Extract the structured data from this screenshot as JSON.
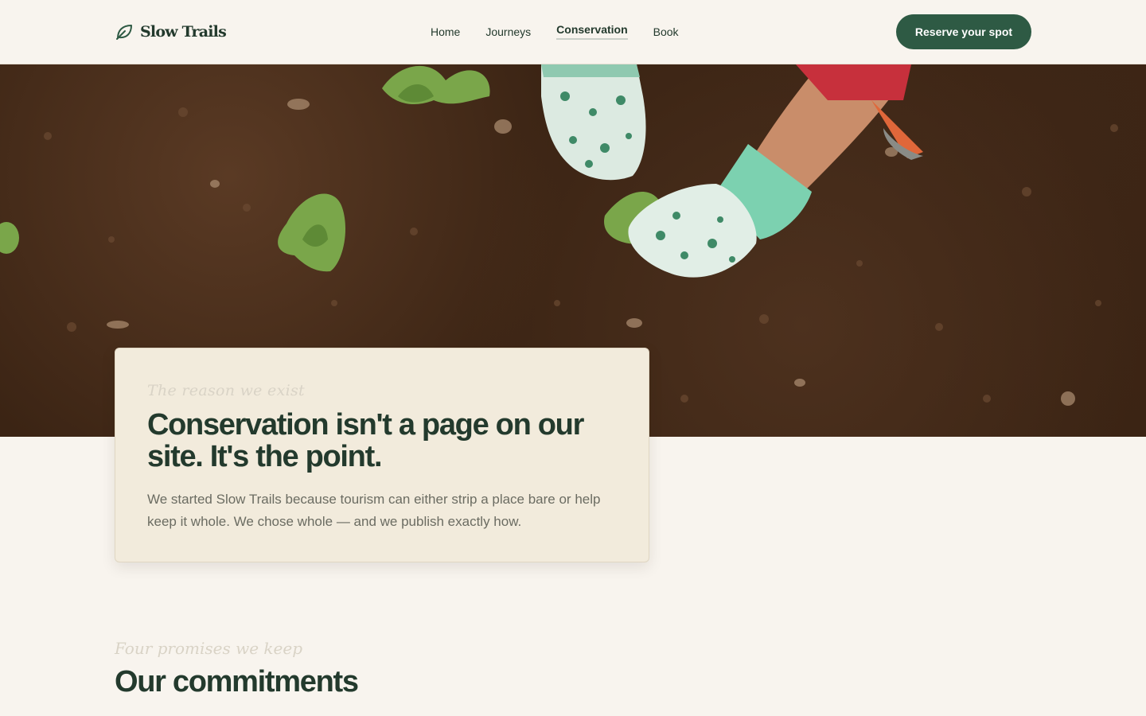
{
  "brand": {
    "name": "Slow Trails",
    "icon": "leaf-icon"
  },
  "nav": {
    "items": [
      {
        "label": "Home"
      },
      {
        "label": "Journeys"
      },
      {
        "label": "Conservation",
        "active": true
      },
      {
        "label": "Book"
      }
    ]
  },
  "header": {
    "cta_label": "Reserve your spot"
  },
  "hero": {
    "image_description": "soil-planting-photo"
  },
  "intro": {
    "eyebrow": "The reason we exist",
    "title": "Conservation isn't a page on our site. It's the point.",
    "body": "We started Slow Trails because tourism can either strip a place bare or help keep it whole. We chose whole — and we publish exactly how."
  },
  "commitments": {
    "eyebrow": "Four promises we keep",
    "title": "Our commitments"
  },
  "colors": {
    "background": "#f8f4ee",
    "primary": "#2e5a44",
    "heading": "#233a2d",
    "card": "#f2ebdc",
    "soil": "#3b2414"
  }
}
